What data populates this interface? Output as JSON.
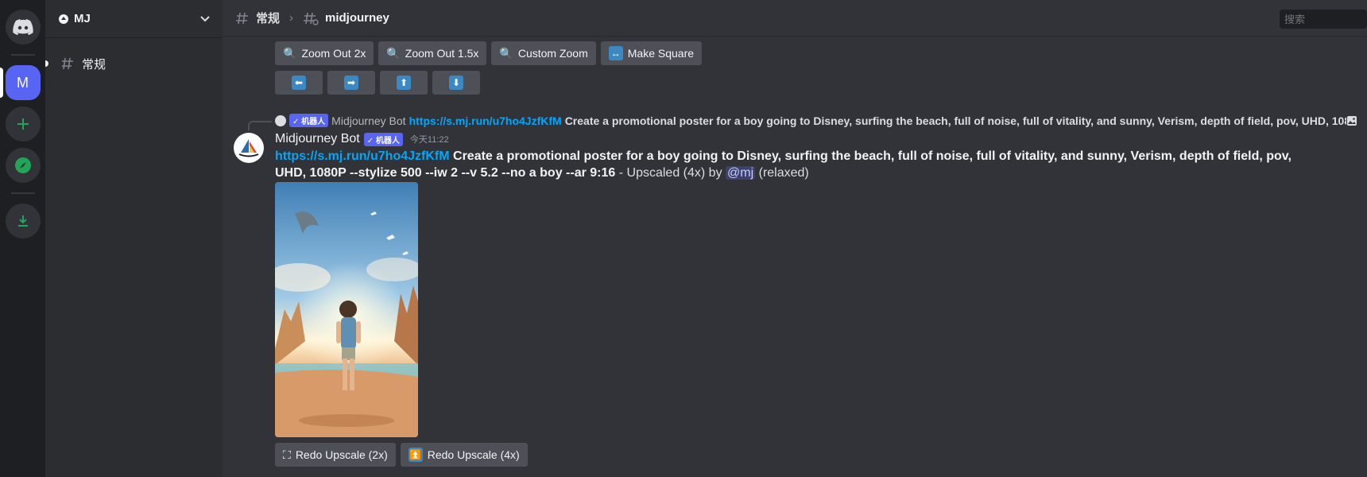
{
  "sidebar": {
    "server_name": "MJ",
    "server_initial": "M",
    "channels": [
      {
        "label": "常规"
      }
    ]
  },
  "topbar": {
    "channel": "常规",
    "thread": "midjourney",
    "search_placeholder": "搜索"
  },
  "buttons_row1": [
    {
      "icon": "🔍",
      "label": "Zoom Out 2x"
    },
    {
      "icon": "🔍",
      "label": "Zoom Out 1.5x"
    },
    {
      "icon": "🔍",
      "label": "Custom Zoom"
    },
    {
      "icon": "↔",
      "label": "Make Square"
    }
  ],
  "buttons_row2": [
    {
      "icon": "⬅"
    },
    {
      "icon": "➡"
    },
    {
      "icon": "⬆"
    },
    {
      "icon": "⬇"
    }
  ],
  "reply": {
    "tag": "✓ 机器人",
    "author": "Midjourney Bot",
    "link": "https://s.mj.run/u7ho4JzfKfM",
    "text": "Create a promotional poster for a boy going to Disney, surfing the beach, full of noise, full of vitality, and sunny, Verism, depth of field, pov, UHD, 108"
  },
  "message": {
    "author": "Midjourney Bot",
    "tag": "✓ 机器人",
    "timestamp": "今天11:22",
    "link": "https://s.mj.run/u7ho4JzfKfM",
    "prompt": "Create a promotional poster for a boy going to Disney, surfing the beach, full of noise, full of vitality, and sunny, Verism, depth of field, pov, UHD, 1080P --stylize 500 --iw 2 --v 5.2 --no a boy --ar 9:16",
    "suffix": "- Upscaled (4x) by",
    "mention": "@mj",
    "status": "(relaxed)"
  },
  "buttons_bottom": [
    {
      "icon": "⛶",
      "label": "Redo Upscale (2x)"
    },
    {
      "icon": "⏫",
      "label": "Redo Upscale (4x)"
    }
  ],
  "colors": {
    "blurple": "#5865f2",
    "link": "#00a8fc",
    "bg": "#313338"
  }
}
